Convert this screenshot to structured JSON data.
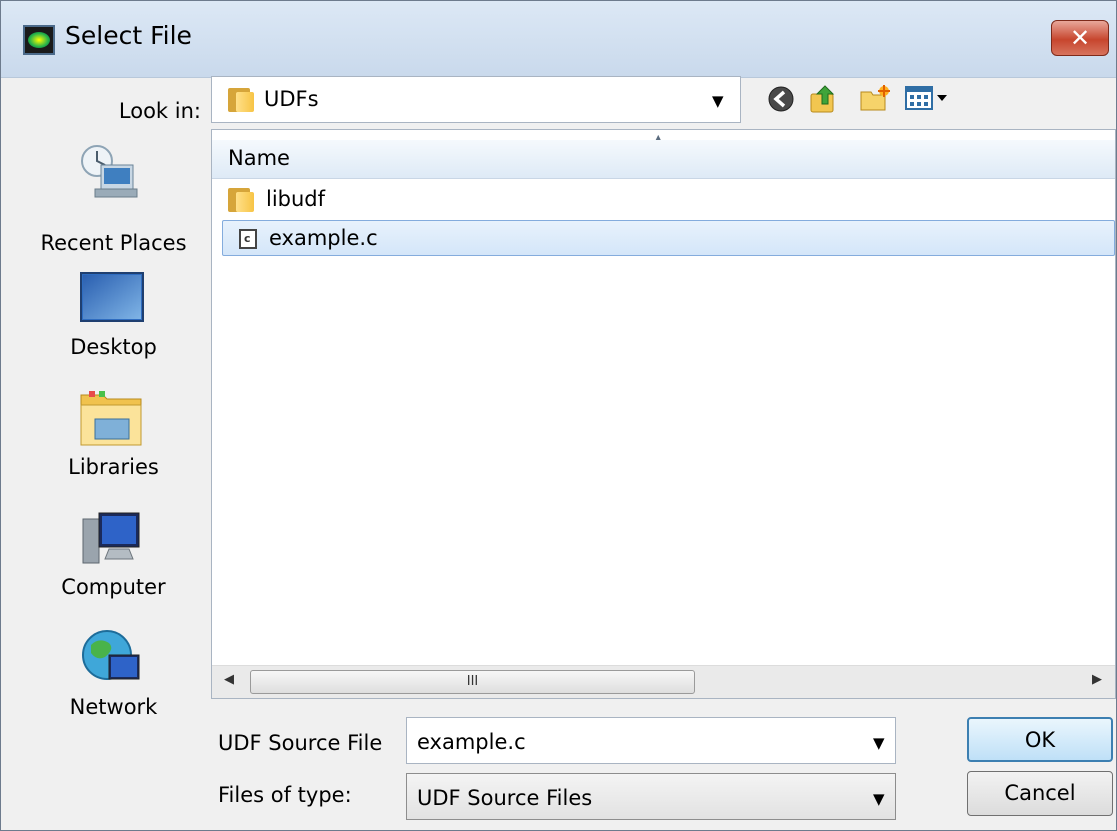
{
  "window": {
    "title": "Select File",
    "close_label": "✕"
  },
  "lookin": {
    "label": "Look in:",
    "value": "UDFs"
  },
  "toolbar": {
    "icons": [
      "back-icon",
      "up-folder-icon",
      "new-folder-icon",
      "view-menu-icon"
    ]
  },
  "places": [
    {
      "label": "Recent Places",
      "icon": "recent-places-icon"
    },
    {
      "label": "Desktop",
      "icon": "desktop-icon"
    },
    {
      "label": "Libraries",
      "icon": "libraries-icon"
    },
    {
      "label": "Computer",
      "icon": "computer-icon"
    },
    {
      "label": "Network",
      "icon": "network-icon"
    }
  ],
  "filelist": {
    "column_header": "Name",
    "items": [
      {
        "name": "libudf",
        "type": "folder",
        "selected": false
      },
      {
        "name": "example.c",
        "type": "c-file",
        "selected": true
      }
    ],
    "scroll_thumb_label": "III"
  },
  "filename": {
    "label": "UDF Source File",
    "value": "example.c"
  },
  "filetype": {
    "label": "Files of type:",
    "value": "UDF Source Files"
  },
  "buttons": {
    "ok": "OK",
    "cancel": "Cancel"
  },
  "colors": {
    "titlebar": "#c9d9ec",
    "selection": "#d4e6f9",
    "close_button": "#c7462e"
  }
}
